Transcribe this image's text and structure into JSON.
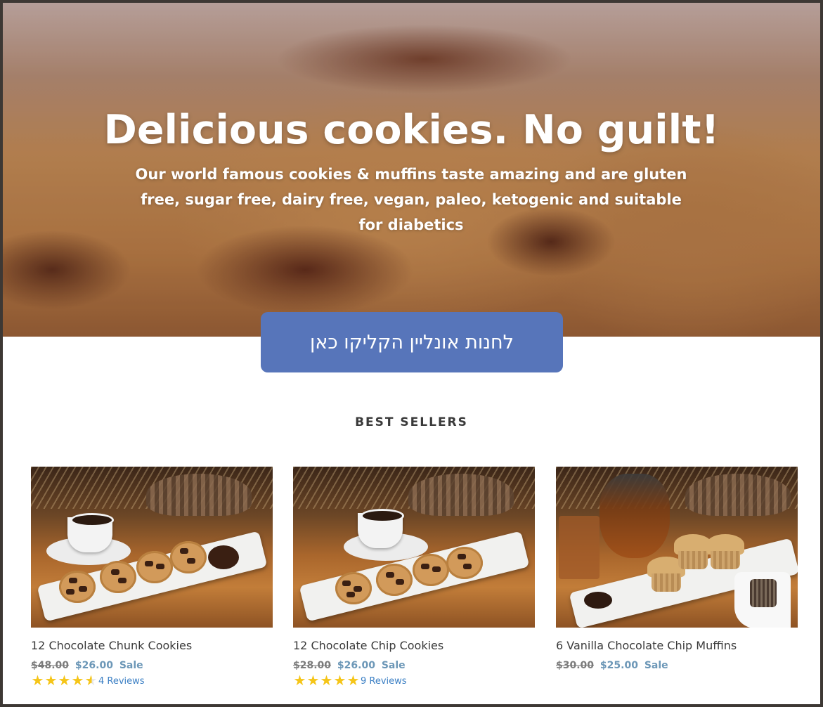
{
  "hero": {
    "title": "Delicious cookies. No guilt!",
    "subtitle": "Our world famous cookies & muffins taste amazing and are gluten free, sugar free, dairy free, vegan, paleo, ketogenic and suitable for diabetics",
    "cta_label": "לחנות אונליין הקליקו כאן"
  },
  "section": {
    "title": "BEST SELLERS"
  },
  "products": [
    {
      "name": "12 Chocolate Chunk Cookies",
      "old_price": "$48.00",
      "new_price": "$26.00",
      "sale_label": "Sale",
      "rating": 4.5,
      "reviews": "4 Reviews"
    },
    {
      "name": "12 Chocolate Chip Cookies",
      "old_price": "$28.00",
      "new_price": "$26.00",
      "sale_label": "Sale",
      "rating": 5,
      "reviews": "9 Reviews"
    },
    {
      "name": "6 Vanilla Chocolate Chip Muffins",
      "old_price": "$30.00",
      "new_price": "$25.00",
      "sale_label": "Sale"
    }
  ],
  "colors": {
    "cta": "#5775ba",
    "sale_price": "#6c97b7",
    "star": "#f5c518",
    "review_link": "#3b7fc4"
  },
  "icons": {
    "rating": "star-icon"
  }
}
